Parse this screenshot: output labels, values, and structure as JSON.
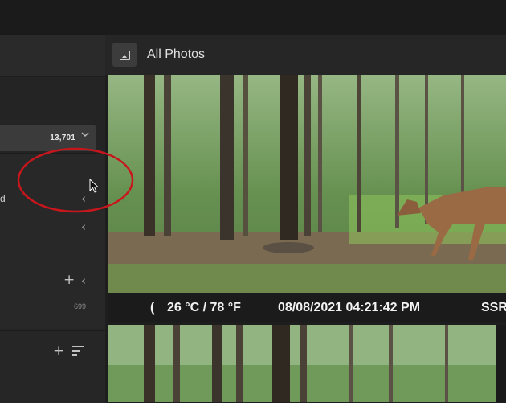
{
  "header": {
    "title": "All Photos"
  },
  "sidebar": {
    "all_photos_count": "13,701",
    "row_label": "d",
    "small_count": "699"
  },
  "photo_stamp": {
    "temperature": "26 °C / 78 °F",
    "datetime": "08/08/2021 04:21:42 PM",
    "suffix": "SSR",
    "prefix": "("
  },
  "colors": {
    "annotation_circle": "#c8161d",
    "panel_bg": "#252525",
    "highlight_row": "#3b3b3b"
  },
  "icons": [
    "photo-icon",
    "chevron-down-icon",
    "chevron-left-icon",
    "plus-icon",
    "sort-icon",
    "cursor-icon"
  ]
}
